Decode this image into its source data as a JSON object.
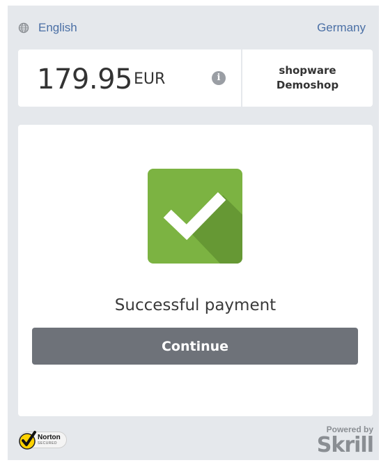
{
  "header": {
    "language": "English",
    "language_icon": "globe-icon",
    "country": "Germany"
  },
  "payment": {
    "amount": "179.95",
    "currency": "EUR",
    "info_icon": "info-icon",
    "merchant_line1": "shopware",
    "merchant_line2": "Demoshop"
  },
  "status": {
    "icon": "checkmark-icon",
    "message": "Successful payment",
    "continue_label": "Continue",
    "colors": {
      "success": "#7cb342",
      "button": "#6e7279",
      "link": "#4a6fa5"
    }
  },
  "footer": {
    "norton_name": "Norton",
    "norton_sub": "SECURED",
    "powered_by": "Powered by",
    "brand": "Skrill"
  }
}
